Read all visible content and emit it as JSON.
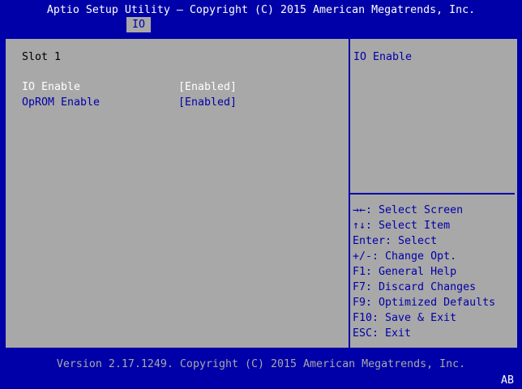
{
  "header": {
    "title": "Aptio Setup Utility – Copyright (C) 2015 American Megatrends, Inc.",
    "tab": "IO"
  },
  "main": {
    "section_title": "Slot 1",
    "items": [
      {
        "label": "IO Enable",
        "value": "[Enabled]"
      },
      {
        "label": "OpROM Enable",
        "value": "[Enabled]"
      }
    ]
  },
  "help": {
    "description": "IO Enable",
    "keys": [
      "→←: Select Screen",
      "↑↓: Select Item",
      "Enter: Select",
      "+/-: Change Opt.",
      "F1: General Help",
      "F7: Discard Changes",
      "F9: Optimized Defaults",
      "F10: Save & Exit",
      "ESC: Exit"
    ]
  },
  "footer": {
    "version": "Version 2.17.1249. Copyright (C) 2015 American Megatrends, Inc.",
    "indicator": "AB"
  },
  "colors": {
    "background": "#0000a8",
    "panel": "#a8a8a8",
    "text_dark": "#000000",
    "text_blue": "#0000a8",
    "text_white": "#ffffff"
  }
}
